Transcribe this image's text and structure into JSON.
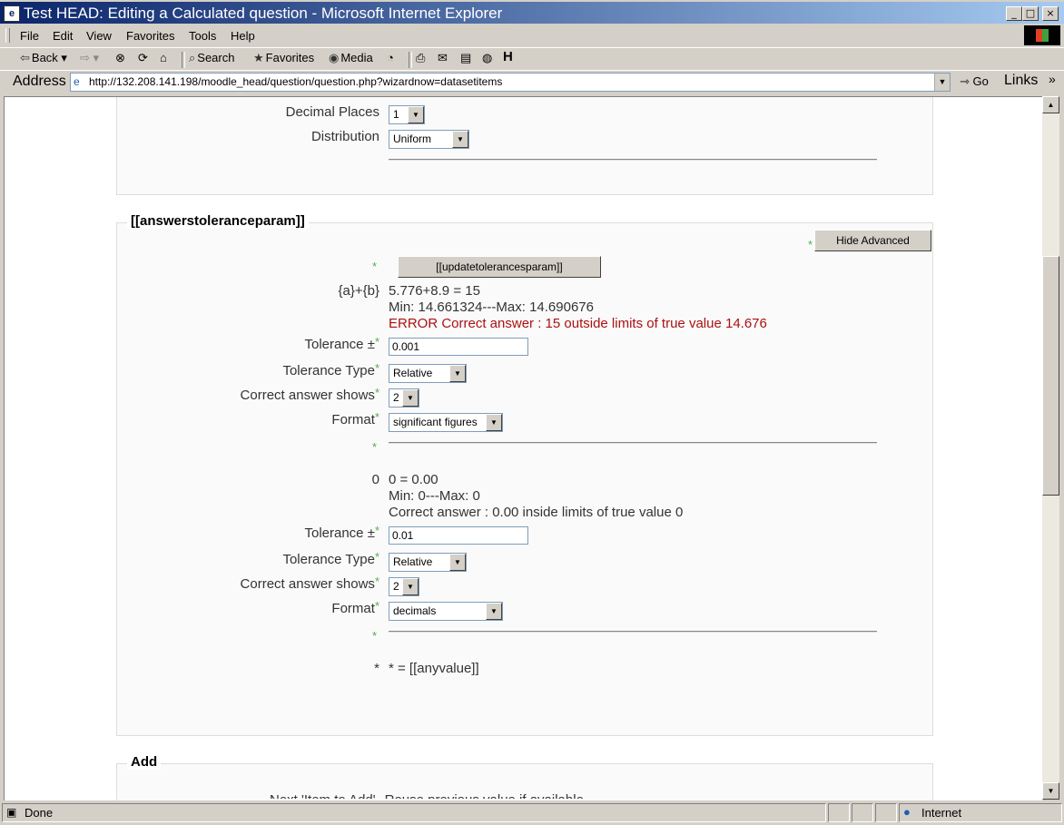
{
  "window": {
    "title": "Test HEAD: Editing a Calculated question - Microsoft Internet Explorer",
    "controls": [
      "_",
      "□",
      "×"
    ]
  },
  "menubar": {
    "items": [
      {
        "label": "File"
      },
      {
        "label": "Edit"
      },
      {
        "label": "View"
      },
      {
        "label": "Favorites"
      },
      {
        "label": "Tools"
      },
      {
        "label": "Help"
      }
    ]
  },
  "toolbar": {
    "back": "Back",
    "search": "Search",
    "favorites": "Favorites",
    "media": "Media"
  },
  "addressbar": {
    "label": "Address",
    "url": "http://132.208.141.198/moodle_head/question/question.php?wizardnow=datasetitems",
    "go": "Go",
    "links": "Links"
  },
  "top_section": {
    "decimal_places_label": "Decimal Places",
    "decimal_places_value": "1",
    "distribution_label": "Distribution",
    "distribution_value": "Uniform"
  },
  "tolerance_section": {
    "legend": "[[answerstoleranceparam]]",
    "hide_advanced": "Hide Advanced",
    "update_button": "[[updatetolerancesparam]]",
    "required_mark": "*",
    "answer1": {
      "formula_label": "{a}+{b}",
      "line1": "5.776+8.9 = 15",
      "line2": "Min: 14.661324---Max: 14.690676",
      "error": "ERROR Correct answer : 15 outside limits of true value 14.676",
      "tolerance_label": "Tolerance ±",
      "tolerance_value": "0.001",
      "tolerance_type_label": "Tolerance Type",
      "tolerance_type_value": "Relative",
      "correct_shows_label": "Correct answer shows",
      "correct_shows_value": "2",
      "format_label": "Format",
      "format_value": "significant figures"
    },
    "answer2": {
      "formula_label": "0",
      "line1": "0 = 0.00",
      "line2": "Min: 0---Max: 0",
      "line3": "Correct answer : 0.00 inside limits of true value 0",
      "tolerance_label": "Tolerance ±",
      "tolerance_value": "0.01",
      "tolerance_type_label": "Tolerance Type",
      "tolerance_type_value": "Relative",
      "correct_shows_label": "Correct answer shows",
      "correct_shows_value": "2",
      "format_label": "Format",
      "format_value": "decimals"
    },
    "answer3": {
      "formula_label": "*",
      "line1": "* = [[anyvalue]]"
    }
  },
  "add_section": {
    "legend": "Add",
    "partial_label": "Next 'Item to Add'",
    "partial_value": "Reuse previous value if available"
  },
  "statusbar": {
    "status": "Done",
    "zone": "Internet"
  }
}
